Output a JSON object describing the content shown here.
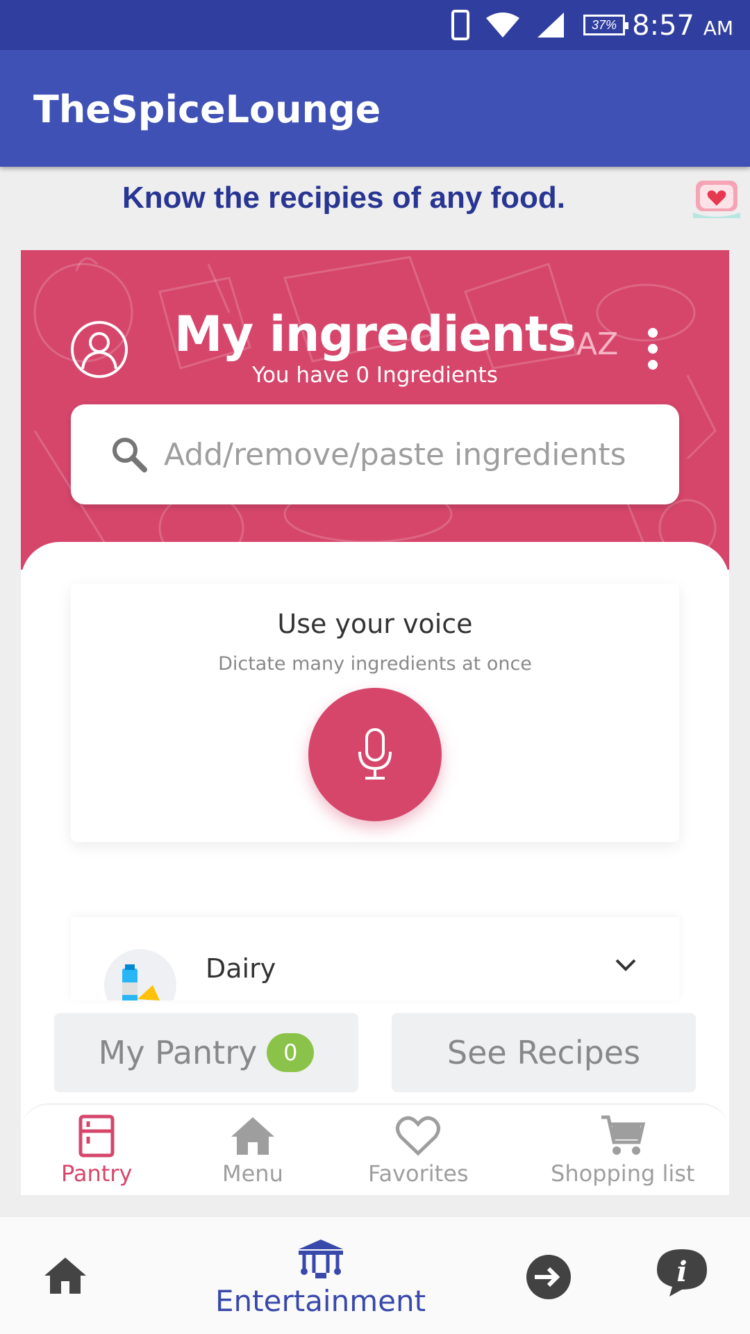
{
  "status_bar": {
    "battery": "37%",
    "time": "8:57",
    "ampm": "AM"
  },
  "app_bar": {
    "title": "TheSpiceLounge"
  },
  "tagline": "Know the recipies of any food.",
  "hero": {
    "heading": "My ingredients",
    "subtitle": "You have 0 Ingredients",
    "sort_label": "AZ",
    "search_placeholder": "Add/remove/paste ingredients"
  },
  "voice_card": {
    "title": "Use your voice",
    "subtitle": "Dictate many ingredients at once"
  },
  "categories": [
    {
      "label": "Dairy"
    }
  ],
  "actions": {
    "pantry_label": "My Pantry",
    "pantry_count": "0",
    "recipes_label": "See Recipes"
  },
  "tabs": [
    {
      "label": "Pantry",
      "icon": "fridge-icon"
    },
    {
      "label": "Menu",
      "icon": "home-icon"
    },
    {
      "label": "Favorites",
      "icon": "heart-icon"
    },
    {
      "label": "Shopping list",
      "icon": "cart-icon"
    }
  ],
  "bottom_nav": {
    "entertainment_label": "Entertainment"
  },
  "colors": {
    "primary": "#3f51b5",
    "primary_dark": "#303f9f",
    "accent": "#d6466b",
    "badge": "#8bc34a"
  }
}
